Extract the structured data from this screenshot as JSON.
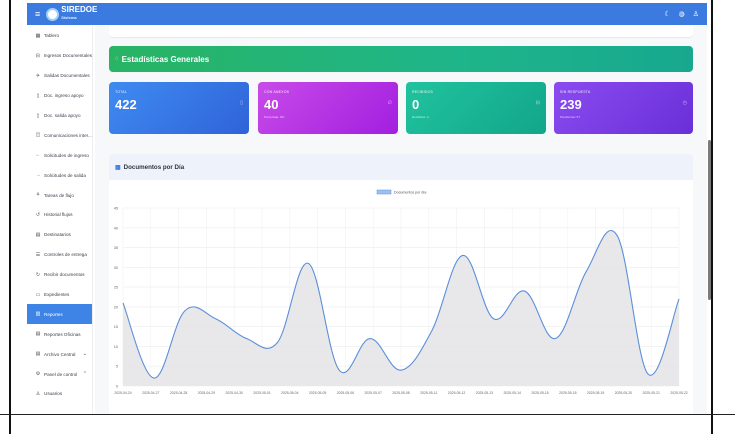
{
  "app": {
    "logo_text": "SIREDOE",
    "logo_sub": "Sistema"
  },
  "topbar": {
    "menu_icon": "menu-icon",
    "icons": [
      "moon-icon",
      "bell-icon",
      "user-icon"
    ]
  },
  "sidebar": {
    "items": [
      {
        "label": "Tablero",
        "icon": "grid-icon",
        "glyph": "▦"
      },
      {
        "label": "Ingresos Documentales",
        "icon": "inbox-icon",
        "glyph": "⊟"
      },
      {
        "label": "Salidas Documentales",
        "icon": "send-icon",
        "glyph": "✈"
      },
      {
        "label": "Doc. ingreso apoyo",
        "icon": "file-icon",
        "glyph": "▯"
      },
      {
        "label": "Doc. salida apoyo",
        "icon": "file-out-icon",
        "glyph": "▯"
      },
      {
        "label": "Comunicaciones inter...",
        "icon": "chat-icon",
        "glyph": "◫"
      },
      {
        "label": "Solicitudes de ingreso",
        "icon": "arrow-left-icon",
        "glyph": "←"
      },
      {
        "label": "Solicitudes de salida",
        "icon": "arrow-right-icon",
        "glyph": "→"
      },
      {
        "label": "Tareas de flujo",
        "icon": "sitemap-icon",
        "glyph": "⚘"
      },
      {
        "label": "Historial flujos",
        "icon": "history-icon",
        "glyph": "↺"
      },
      {
        "label": "Destinatarios",
        "icon": "list-icon",
        "glyph": "▤"
      },
      {
        "label": "Controles de entrega",
        "icon": "check-list-icon",
        "glyph": "☰"
      },
      {
        "label": "Recibir documentos",
        "icon": "receive-icon",
        "glyph": "↻"
      },
      {
        "label": "Expedientes",
        "icon": "folder-icon",
        "glyph": "▭"
      },
      {
        "label": "Reportes",
        "icon": "chart-icon",
        "glyph": "▥",
        "active": true
      },
      {
        "label": "Reportes Oficinas",
        "icon": "report-icon",
        "glyph": "▤"
      },
      {
        "label": "Archivo Central",
        "icon": "archive-icon",
        "glyph": "▤",
        "chevron": "⌄"
      },
      {
        "label": "Panel de control",
        "icon": "settings-icon",
        "glyph": "⚙",
        "chevron": "⌃"
      },
      {
        "label": "Usuarios",
        "icon": "users-icon",
        "glyph": "♙"
      }
    ]
  },
  "stats": {
    "title": "Estadísticas Generales",
    "cards": [
      {
        "label": "TOTAL",
        "value": "422",
        "sub": "",
        "icon": "file-icon"
      },
      {
        "label": "CON ANEXOS",
        "value": "40",
        "sub": "Porcentaje: 9%",
        "icon": "paperclip-icon"
      },
      {
        "label": "RECIBIDOS",
        "value": "0",
        "sub": "Recibidos: 0",
        "icon": "inbox-icon"
      },
      {
        "label": "SIN RESPUESTA",
        "value": "239",
        "sub": "Pendientes: 57",
        "icon": "clock-icon"
      }
    ]
  },
  "chart_section": {
    "title": "Documentos por Día"
  },
  "chart_data": {
    "type": "area",
    "legend": [
      "Documentos por día"
    ],
    "legend_position": "top-center",
    "grid": true,
    "ylim": [
      0,
      45
    ],
    "y_ticks": [
      0,
      5,
      10,
      15,
      20,
      25,
      30,
      35,
      40,
      45
    ],
    "categories": [
      "2025-04-24",
      "2025-04-27",
      "2025-04-28",
      "2025-04-29",
      "2025-04-30",
      "2025-05-01",
      "2025-05-04",
      "2025-05-05",
      "2025-05-06",
      "2025-05-07",
      "2025-05-08",
      "2025-05-11",
      "2025-05-12",
      "2025-05-13",
      "2025-05-14",
      "2025-05-15",
      "2025-05-18",
      "2025-05-19",
      "2025-05-20",
      "2025-05-21",
      "2025-05-22"
    ],
    "series": [
      {
        "name": "Documentos por día",
        "values": [
          21,
          2,
          19,
          17,
          12,
          11,
          31,
          4,
          12,
          4,
          14,
          33,
          17,
          24,
          12,
          29,
          38,
          3,
          22
        ]
      }
    ],
    "colors": {
      "line": "#5b8fd9",
      "fill": "#e4e4e6",
      "legend": "#9ec1ef"
    }
  }
}
